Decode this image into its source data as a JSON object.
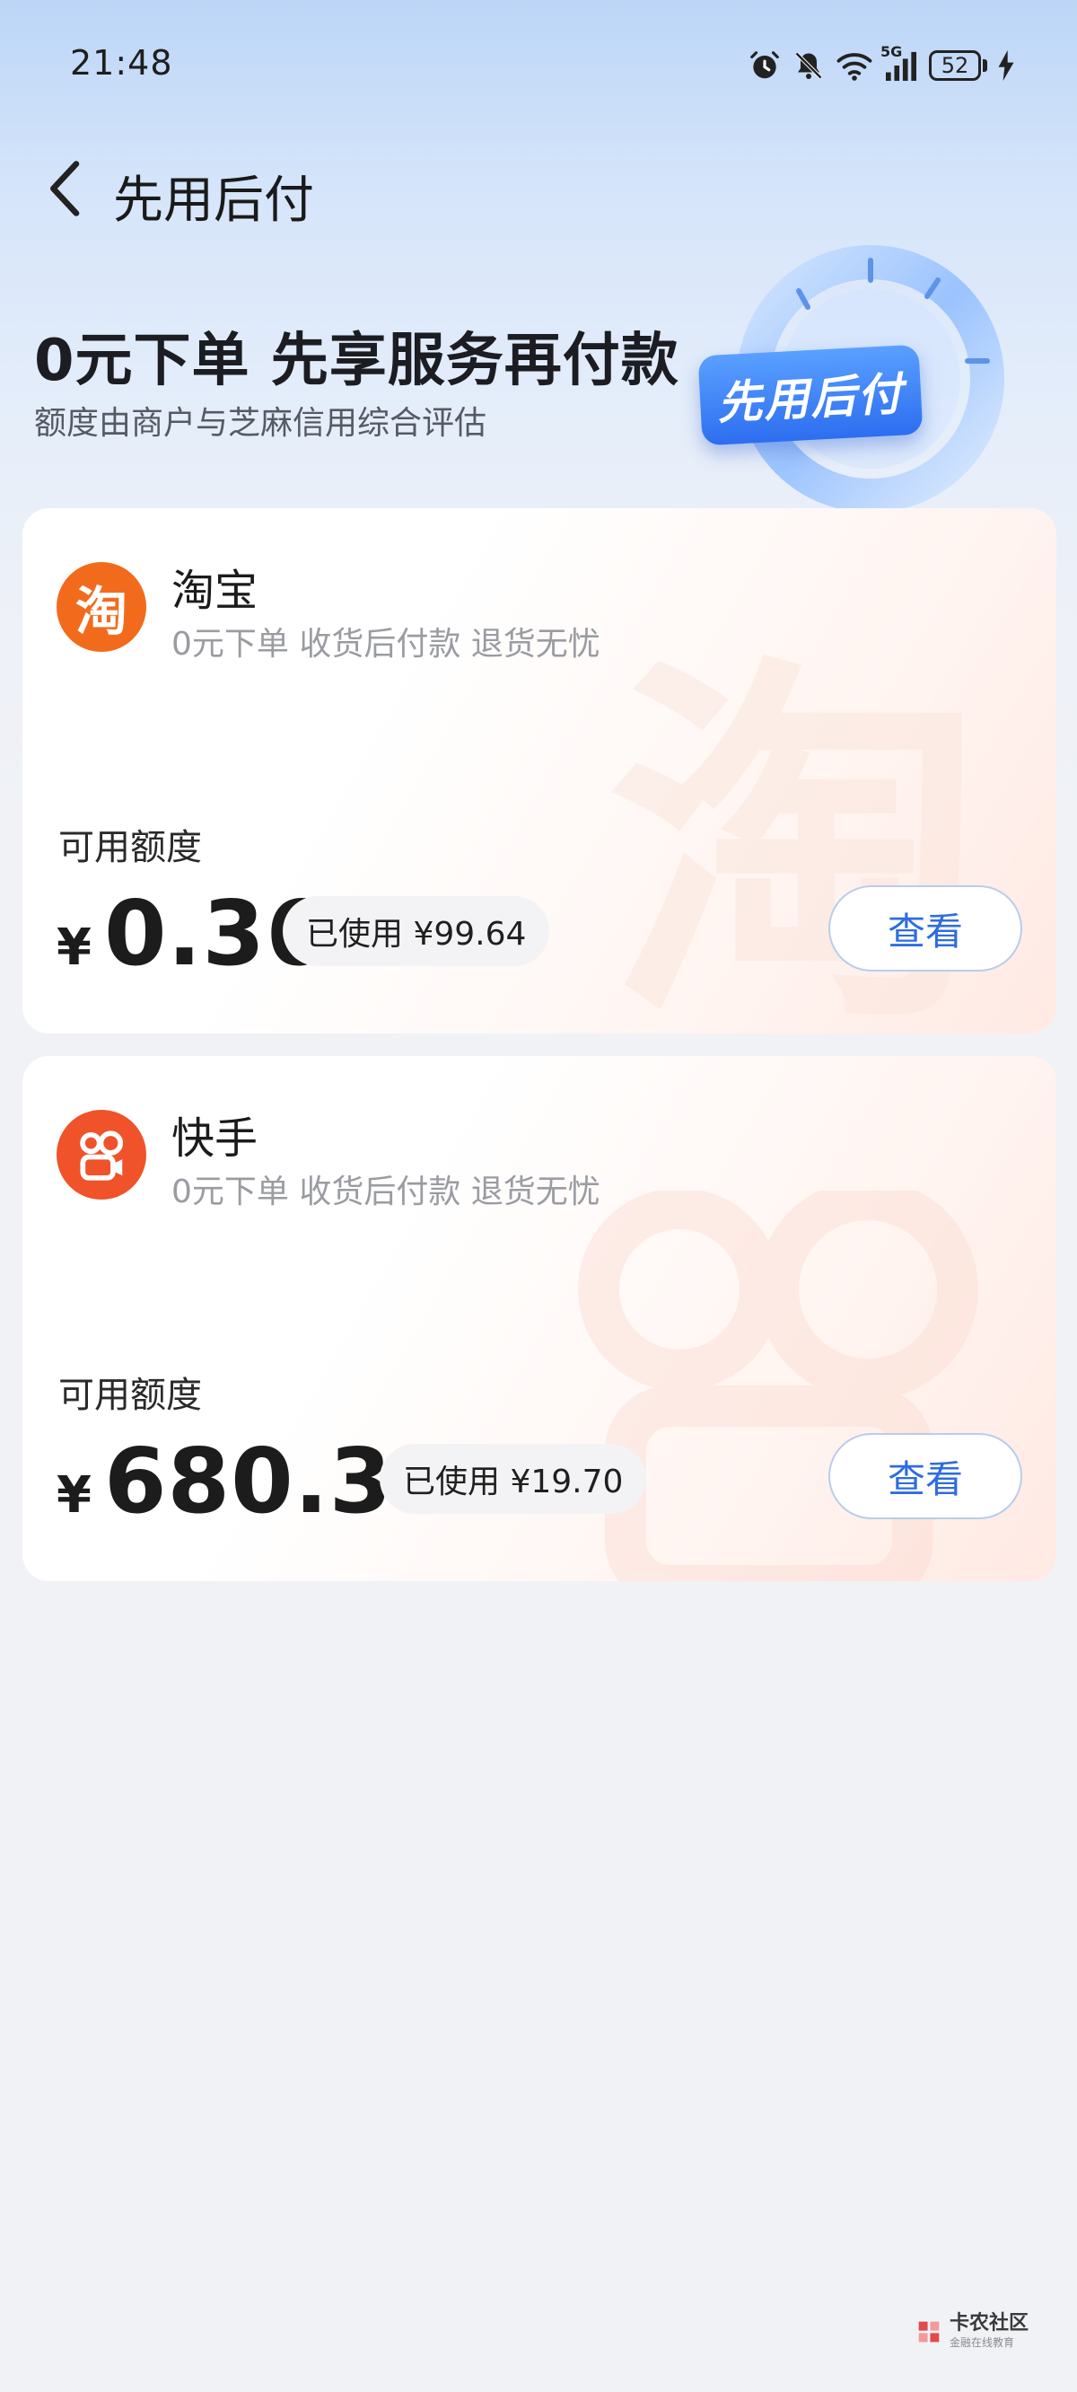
{
  "status_bar": {
    "time": "21:48",
    "network": "5G",
    "battery": "52",
    "icons": [
      "alarm-icon",
      "mute-icon",
      "wifi-icon",
      "signal-icon",
      "battery-icon",
      "charging-icon"
    ]
  },
  "header": {
    "back_icon": "chevron-left-icon",
    "title": "先用后付"
  },
  "hero": {
    "title": "0元下单 先享服务再付款",
    "subtitle": "额度由商户与芝麻信用综合评估",
    "badge_label": "先用后付"
  },
  "cards": [
    {
      "name": "淘宝",
      "logo_char": "淘",
      "logo_color": "#f26b1d",
      "description": "0元下单 收货后付款 退货无忧",
      "limit_label": "可用额度",
      "currency": "¥",
      "amount": "0.36",
      "used": "已使用 ¥99.64",
      "button": "查看"
    },
    {
      "name": "快手",
      "logo_char": "",
      "logo_color": "#f0522a",
      "description": "0元下单 收货后付款 退货无忧",
      "limit_label": "可用额度",
      "currency": "¥",
      "amount": "680.30",
      "used": "已使用 ¥19.70",
      "button": "查看"
    }
  ],
  "footer": {
    "brand": "卡农社区",
    "brand_sub": "金融在线教育"
  },
  "colors": {
    "accent": "#2f6ce0",
    "taobao": "#f26b1d",
    "kuaishou": "#f0522a"
  }
}
